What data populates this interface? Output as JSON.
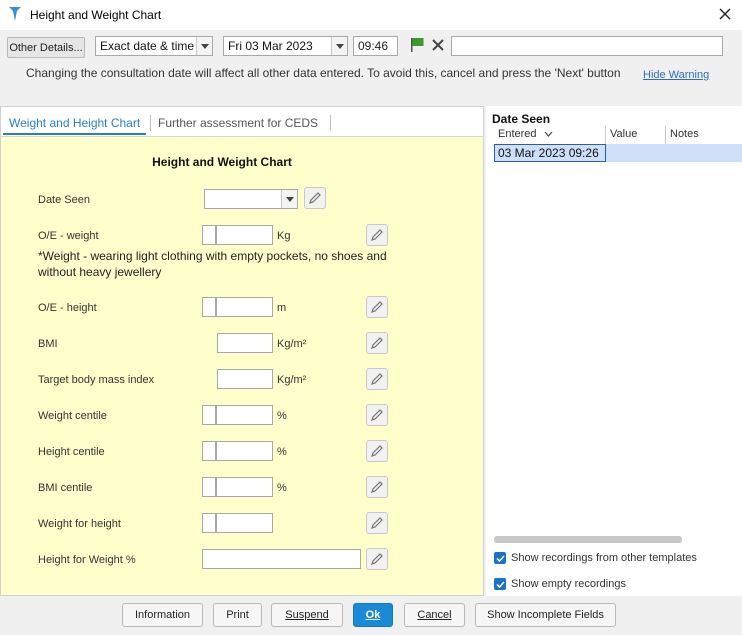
{
  "window": {
    "title": "Height and Weight Chart"
  },
  "toolbar": {
    "other_details": "Other Details...",
    "date_mode": "Exact date & time",
    "date_value": "Fri 03 Mar 2023",
    "time_value": "09:46",
    "free_text": ""
  },
  "warning": {
    "text": "Changing the consultation date will affect all other data entered. To avoid this, cancel and press the 'Next' button",
    "hide_label": "Hide Warning"
  },
  "tabs": [
    {
      "label": "Weight and Height Chart",
      "active": true
    },
    {
      "label": "Further assessment for CEDS",
      "active": false
    }
  ],
  "form": {
    "title": "Height and Weight Chart",
    "fields": [
      {
        "label": "Date Seen",
        "unit": ""
      },
      {
        "label": "O/E - weight",
        "unit": "Kg"
      },
      {
        "label": "O/E - height",
        "unit": "m"
      },
      {
        "label": "BMI",
        "unit": "Kg/m²"
      },
      {
        "label": "Target body mass index",
        "unit": "Kg/m²"
      },
      {
        "label": "Weight centile",
        "unit": "%"
      },
      {
        "label": "Height centile",
        "unit": "%"
      },
      {
        "label": "BMI centile",
        "unit": "%"
      },
      {
        "label": "Weight for height",
        "unit": ""
      },
      {
        "label": "Height for Weight %",
        "unit": ""
      }
    ],
    "weight_note": "*Weight - wearing light clothing with empty pockets, no shoes and without heavy jewellery"
  },
  "right_panel": {
    "title": "Date Seen",
    "columns": [
      "Entered",
      "Value",
      "Notes"
    ],
    "rows": [
      {
        "entered": "03 Mar 2023 09:26",
        "value": "",
        "notes": ""
      }
    ],
    "options": [
      {
        "label": "Show recordings from other templates",
        "checked": true
      },
      {
        "label": "Show empty recordings",
        "checked": true
      }
    ]
  },
  "buttons": {
    "information": "Information",
    "print": "Print",
    "suspend": "Suspend",
    "ok": "Ok",
    "cancel": "Cancel",
    "show_incomplete": "Show Incomplete Fields"
  },
  "colors": {
    "form_bg": "#ffffcc",
    "accent": "#2a7ec5",
    "primary_button": "#1a8ad8",
    "flag": "#3a9a2a"
  }
}
